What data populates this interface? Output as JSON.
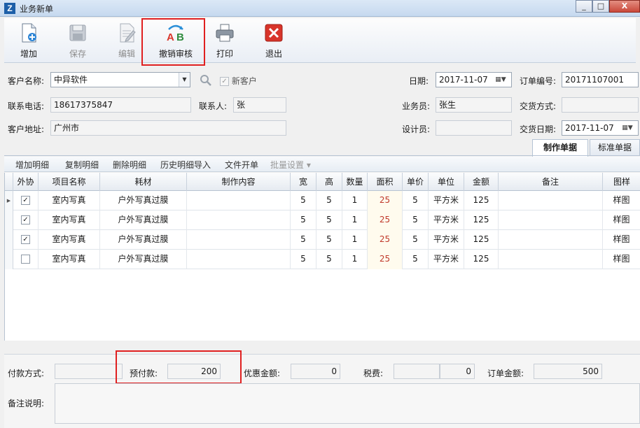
{
  "window": {
    "title": "业务新单",
    "app_icon": "Z",
    "min": "_",
    "max": "□",
    "close": "X"
  },
  "toolbar": {
    "add": "增加",
    "save": "保存",
    "edit": "编辑",
    "unreview": "撤销审核",
    "print": "打印",
    "exit": "退出"
  },
  "form": {
    "customer_label": "客户名称:",
    "customer_value": "中异软件",
    "new_customer_label": "新客户",
    "phone_label": "联系电话:",
    "phone_value": "18617375847",
    "contact_label": "联系人:",
    "contact_value": "张",
    "address_label": "客户地址:",
    "address_value": "广州市",
    "date_label": "日期:",
    "date_value": "2017-11-07",
    "order_no_label": "订单编号:",
    "order_no_value": "20171107001",
    "salesman_label": "业务员:",
    "salesman_value": "张生",
    "delivery_method_label": "交货方式:",
    "delivery_method_value": "",
    "designer_label": "设计员:",
    "designer_value": "",
    "delivery_date_label": "交货日期:",
    "delivery_date_value": "2017-11-07"
  },
  "tabs": [
    "制作单据",
    "标准单据"
  ],
  "detail_toolbar": [
    "增加明细",
    "复制明细",
    "删除明细",
    "历史明细导入",
    "文件开单",
    "批量设置 ▾"
  ],
  "grid": {
    "columns": [
      "外协",
      "项目名称",
      "耗材",
      "制作内容",
      "宽",
      "高",
      "数量",
      "面积",
      "单价",
      "单位",
      "金额",
      "备注",
      "图样"
    ],
    "rows": [
      {
        "outsource": true,
        "item": "室内写真",
        "material": "户外写真过膜",
        "content": "",
        "w": "5",
        "h": "5",
        "qty": "1",
        "area": "25",
        "price": "5",
        "unit": "平方米",
        "amount": "125",
        "note": "",
        "sample": "样图"
      },
      {
        "outsource": true,
        "item": "室内写真",
        "material": "户外写真过膜",
        "content": "",
        "w": "5",
        "h": "5",
        "qty": "1",
        "area": "25",
        "price": "5",
        "unit": "平方米",
        "amount": "125",
        "note": "",
        "sample": "样图"
      },
      {
        "outsource": true,
        "item": "室内写真",
        "material": "户外写真过膜",
        "content": "",
        "w": "5",
        "h": "5",
        "qty": "1",
        "area": "25",
        "price": "5",
        "unit": "平方米",
        "amount": "125",
        "note": "",
        "sample": "样图"
      },
      {
        "outsource": false,
        "item": "室内写真",
        "material": "户外写真过膜",
        "content": "",
        "w": "5",
        "h": "5",
        "qty": "1",
        "area": "25",
        "price": "5",
        "unit": "平方米",
        "amount": "125",
        "note": "",
        "sample": "样图"
      }
    ]
  },
  "footer": {
    "payment_method_label": "付款方式:",
    "payment_method_value": "",
    "prepay_label": "预付款:",
    "prepay_value": "200",
    "discount_label": "优惠金额:",
    "discount_value": "0",
    "tax_label": "税费:",
    "tax_value": "0",
    "order_amount_label": "订单金额:",
    "order_amount_value": "500",
    "memo_label": "备注说明:"
  },
  "colors": {
    "highlight": "#e02020",
    "area_text": "#c0392b"
  }
}
